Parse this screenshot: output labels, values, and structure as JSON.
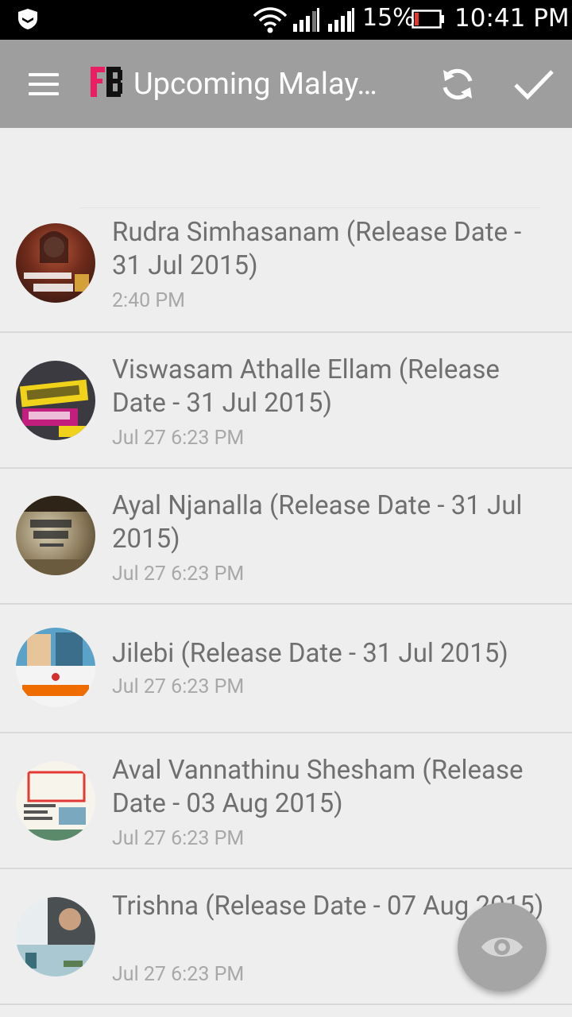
{
  "status_bar": {
    "battery_percent": "15%",
    "time": "10:41 PM"
  },
  "app_bar": {
    "title": "Upcoming Malay…",
    "icons": [
      "menu-icon",
      "fb-logo",
      "refresh-icon",
      "check-icon"
    ]
  },
  "items": [
    {
      "title": "Rudra Simhasanam (Release Date - 31 Jul 2015)",
      "time": "2:40 PM"
    },
    {
      "title": "Viswasam Athalle Ellam (Release Date - 31 Jul 2015)",
      "time": "Jul 27 6:23 PM"
    },
    {
      "title": "Ayal Njanalla (Release Date - 31 Jul 2015)",
      "time": "Jul 27 6:23 PM"
    },
    {
      "title": "Jilebi (Release Date - 31 Jul 2015)",
      "time": "Jul 27 6:23 PM"
    },
    {
      "title": "Aval Vannathinu Shesham (Release Date - 03 Aug 2015)",
      "time": "Jul 27 6:23 PM"
    },
    {
      "title": "Trishna (Release Date - 07 Aug 2015)",
      "time": "Jul 27 6:23 PM"
    }
  ],
  "fab": {
    "icon": "eye-icon"
  },
  "colors": {
    "app_bar": "#9e9e9e",
    "background": "#eeeeee",
    "title_text": "#6f6f6f",
    "time_text": "#a8a8a8",
    "fab": "#a5a5a5"
  }
}
